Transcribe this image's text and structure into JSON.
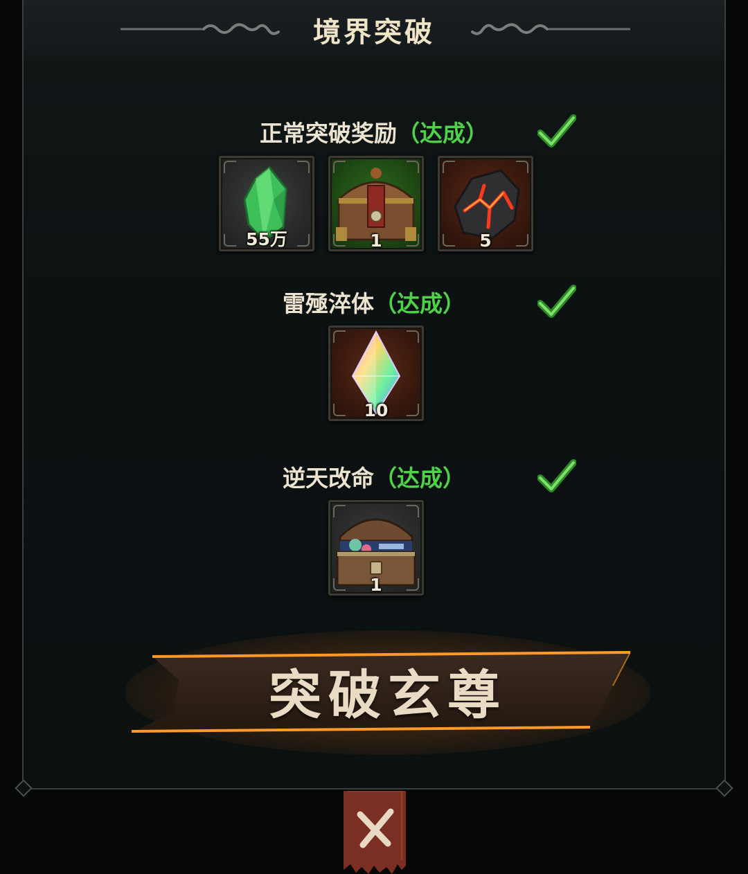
{
  "header": {
    "title": "境界突破"
  },
  "sections": [
    {
      "title": "正常突破奖励",
      "status": "（达成）",
      "items": [
        {
          "icon": "green-crystal-icon",
          "quantity": "55万"
        },
        {
          "icon": "treasure-chest-icon",
          "quantity": "1"
        },
        {
          "icon": "lava-ore-icon",
          "quantity": "5"
        }
      ]
    },
    {
      "title": "雷殛淬体",
      "status": "（达成）",
      "items": [
        {
          "icon": "rainbow-crystal-icon",
          "quantity": "10"
        }
      ]
    },
    {
      "title": "逆天改命",
      "status": "（达成）",
      "items": [
        {
          "icon": "open-treasure-chest-icon",
          "quantity": "1"
        }
      ]
    }
  ],
  "action_button": {
    "label": "突破玄尊"
  },
  "close_button": {
    "icon": "close-icon"
  },
  "colors": {
    "achieved": "#4fd24a",
    "title": "#efe3c8",
    "banner_glow": "#ff8a1c",
    "close_tab": "#7a2f22"
  }
}
